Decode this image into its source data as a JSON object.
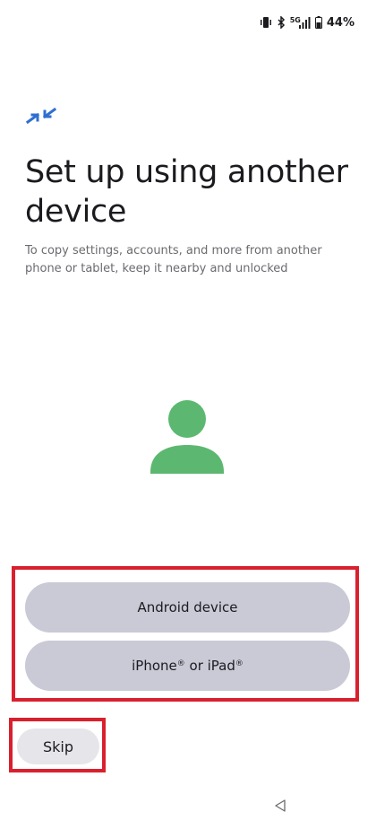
{
  "status_bar": {
    "icons": [
      "vibrate-icon",
      "bluetooth-icon",
      "5g-signal-icon",
      "battery-icon"
    ],
    "network_label": "5G",
    "battery_percent": "44%"
  },
  "header": {
    "icon": "transfer-arrows-icon",
    "title": "Set up using another device",
    "subtitle": "To copy settings, accounts, and more from another phone or tablet, keep it nearby and unlocked"
  },
  "illustration": {
    "icon": "person-icon",
    "color": "#5cb870"
  },
  "options": {
    "android_label": "Android device",
    "iphone_label_part1": "iPhone",
    "iphone_reg1": "®",
    "iphone_label_part2": " or iPad",
    "iphone_reg2": "®",
    "button_color": "#c9cad6"
  },
  "skip": {
    "label": "Skip"
  },
  "nav": {
    "back_icon": "back-triangle-icon"
  },
  "colors": {
    "accent_blue": "#2f6fd0",
    "highlight_red": "#d9202e"
  }
}
